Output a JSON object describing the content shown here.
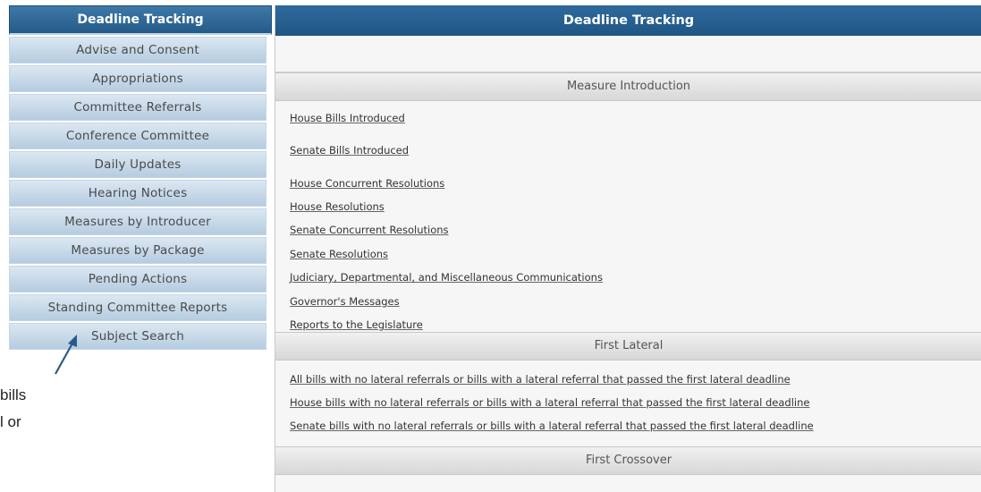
{
  "sidebar": {
    "header": "Deadline Tracking",
    "items": [
      {
        "label": "Advise and Consent"
      },
      {
        "label": "Appropriations"
      },
      {
        "label": "Committee Referrals"
      },
      {
        "label": "Conference Committee"
      },
      {
        "label": "Daily Updates"
      },
      {
        "label": "Hearing Notices"
      },
      {
        "label": "Measures by Introducer"
      },
      {
        "label": "Measures by Package"
      },
      {
        "label": "Pending Actions"
      },
      {
        "label": "Standing Committee Reports"
      },
      {
        "label": "Subject Search"
      }
    ]
  },
  "callout": {
    "line1": "bills",
    "line2": "l or"
  },
  "main": {
    "title": "Deadline Tracking",
    "sections": [
      {
        "title": "Measure Introduction",
        "links": [
          "House Bills Introduced",
          "Senate Bills Introduced",
          "House Concurrent Resolutions",
          "House Resolutions",
          "Senate Concurrent Resolutions",
          "Senate Resolutions",
          "Judiciary, Departmental, and Miscellaneous Communications",
          "Governor's Messages",
          "Reports to the Legislature"
        ]
      },
      {
        "title": "First Lateral",
        "links": [
          "All bills with no lateral referrals or bills with a lateral referral that passed the first lateral deadline",
          "House bills with no lateral referrals or bills with a lateral referral that passed the first lateral deadline",
          "Senate bills with no lateral referrals or bills with a lateral referral that passed the first lateral deadline"
        ]
      },
      {
        "title": "First Crossover",
        "links": []
      }
    ]
  },
  "colors": {
    "header_blue": "#245a88",
    "nav_item_bg": "#c9dbea",
    "section_gray": "#dcdcdc",
    "arrow": "#2b5a8a"
  },
  "icons": {
    "annotation_arrow": "arrow-up-right-icon"
  }
}
